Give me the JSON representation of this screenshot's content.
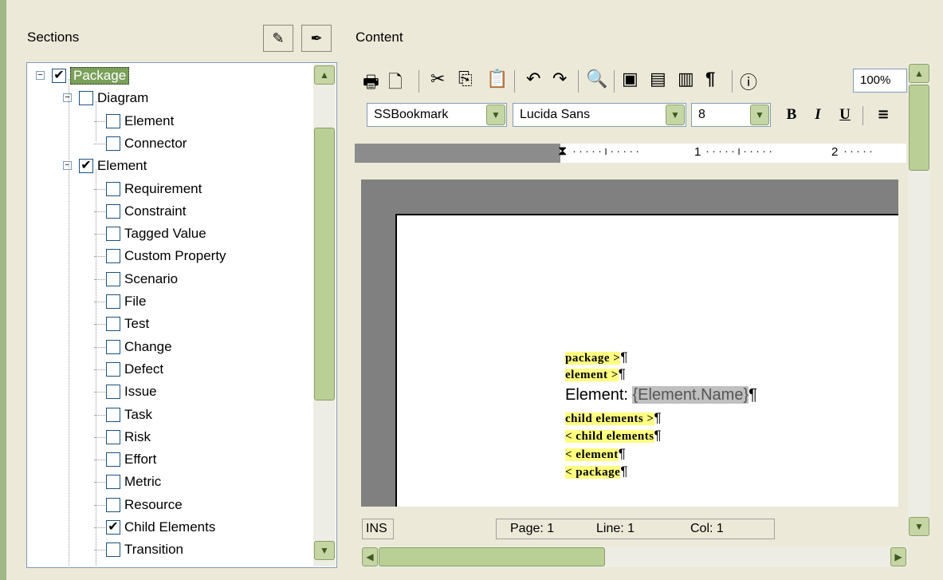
{
  "sections": {
    "title": "Sections",
    "buttons": [
      {
        "icon": "edit-pen-icon"
      },
      {
        "icon": "pen-icon"
      }
    ],
    "tree": [
      {
        "label": "Package",
        "checked": true,
        "level": 0,
        "expander": "−",
        "selected": true
      },
      {
        "label": "Diagram",
        "checked": false,
        "level": 1,
        "expander": "−"
      },
      {
        "label": "Element",
        "checked": false,
        "level": 2
      },
      {
        "label": "Connector",
        "checked": false,
        "level": 2
      },
      {
        "label": "Element",
        "checked": true,
        "level": 1,
        "expander": "−"
      },
      {
        "label": "Requirement",
        "checked": false,
        "level": 2
      },
      {
        "label": "Constraint",
        "checked": false,
        "level": 2
      },
      {
        "label": "Tagged Value",
        "checked": false,
        "level": 2
      },
      {
        "label": "Custom Property",
        "checked": false,
        "level": 2
      },
      {
        "label": "Scenario",
        "checked": false,
        "level": 2
      },
      {
        "label": "File",
        "checked": false,
        "level": 2
      },
      {
        "label": "Test",
        "checked": false,
        "level": 2
      },
      {
        "label": "Change",
        "checked": false,
        "level": 2
      },
      {
        "label": "Defect",
        "checked": false,
        "level": 2
      },
      {
        "label": "Issue",
        "checked": false,
        "level": 2
      },
      {
        "label": "Task",
        "checked": false,
        "level": 2
      },
      {
        "label": "Risk",
        "checked": false,
        "level": 2
      },
      {
        "label": "Effort",
        "checked": false,
        "level": 2
      },
      {
        "label": "Metric",
        "checked": false,
        "level": 2
      },
      {
        "label": "Resource",
        "checked": false,
        "level": 2
      },
      {
        "label": "Child Elements",
        "checked": true,
        "level": 2
      },
      {
        "label": "Transition",
        "checked": false,
        "level": 2
      }
    ]
  },
  "content": {
    "title": "Content",
    "zoom": "100%",
    "style_value": "SSBookmark",
    "font_value": "Lucida Sans",
    "size_value": "8",
    "bold": "B",
    "italic": "I",
    "underline": "U",
    "ruler_1": "1",
    "ruler_2": "2",
    "doc": {
      "l1": "package >",
      "l2": "element >",
      "l3_text": "Element: ",
      "l3_field": "{Element.Name}",
      "l4": "child elements >",
      "l5": "< child elements",
      "l6": "< element",
      "l7": "< package",
      "pilcrow": "¶"
    },
    "status": {
      "mode": "INS",
      "page": "Page: 1",
      "line": "Line: 1",
      "col": "Col: 1"
    }
  },
  "colors": {
    "accent": "#7AA05A",
    "scroll": "#c5d6a4",
    "highlight": "#FFFF80"
  }
}
